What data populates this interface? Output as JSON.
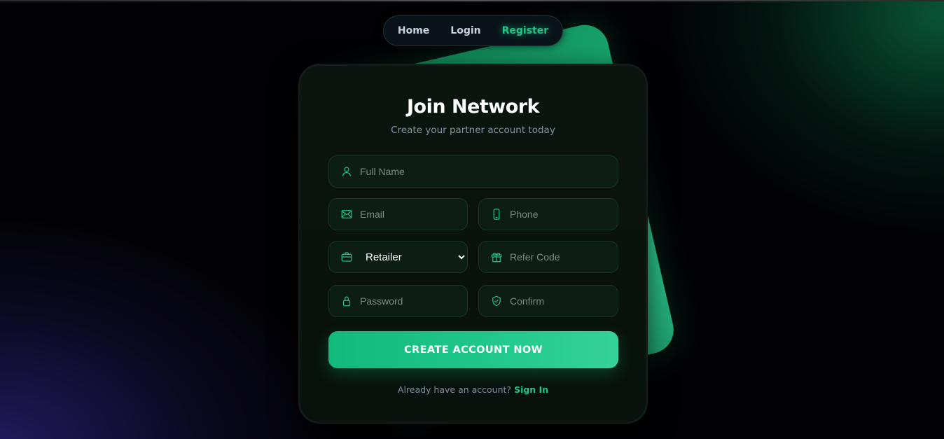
{
  "nav": {
    "items": [
      {
        "label": "Home",
        "active": false
      },
      {
        "label": "Login",
        "active": false
      },
      {
        "label": "Register",
        "active": true
      }
    ]
  },
  "form": {
    "title": "Join Network",
    "subtitle": "Create your partner account today",
    "full_name": {
      "placeholder": "Full Name",
      "icon": "user-icon"
    },
    "email": {
      "placeholder": "Email",
      "icon": "mail-icon"
    },
    "phone": {
      "placeholder": "Phone",
      "icon": "phone-icon"
    },
    "role": {
      "selected": "Retailer",
      "options": [
        "Retailer"
      ],
      "icon": "briefcase-icon"
    },
    "refer_code": {
      "placeholder": "Refer Code",
      "icon": "gift-icon"
    },
    "password": {
      "placeholder": "Password",
      "icon": "lock-icon"
    },
    "confirm": {
      "placeholder": "Confirm",
      "icon": "shield-check-icon"
    },
    "submit_label": "CREATE ACCOUNT NOW",
    "footer_text": "Already have an account?",
    "footer_link": "Sign In"
  },
  "colors": {
    "accent": "#20c487",
    "card_bg": "#0b140f",
    "field_bg": "#0c1d16"
  }
}
